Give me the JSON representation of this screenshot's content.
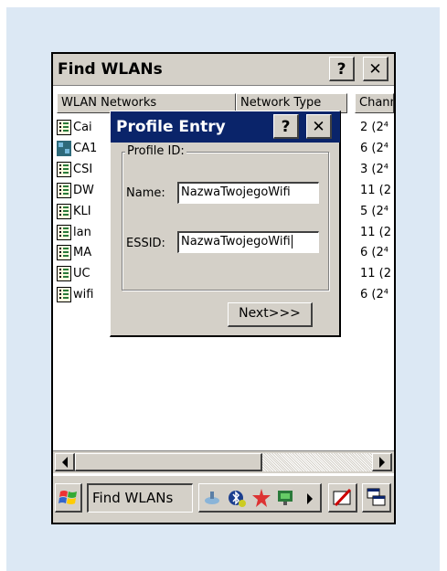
{
  "window": {
    "title": "Find WLANs",
    "help_label": "?",
    "close_label": "✕"
  },
  "columns": [
    "WLAN Networks",
    "Network Type",
    "Channel"
  ],
  "networks": [
    {
      "name": "Cai",
      "channel": "2 (2⁴",
      "icon": "network-icon"
    },
    {
      "name": "CA1",
      "channel": "6 (2⁴",
      "icon": "network-icon-adhoc"
    },
    {
      "name": "CSI",
      "channel": "3 (2⁴",
      "icon": "network-icon"
    },
    {
      "name": "DW",
      "channel": "11 (2",
      "icon": "network-icon"
    },
    {
      "name": "KLI",
      "channel": "5 (2⁴",
      "icon": "network-icon"
    },
    {
      "name": "lan",
      "channel": "11 (2",
      "icon": "network-icon"
    },
    {
      "name": "MA",
      "channel": "6 (2⁴",
      "icon": "network-icon"
    },
    {
      "name": "UC",
      "channel": "11 (2",
      "icon": "network-icon"
    },
    {
      "name": "wifi",
      "channel": "6 (2⁴",
      "icon": "network-icon"
    }
  ],
  "dialog": {
    "title": "Profile Entry",
    "help_label": "?",
    "close_label": "✕",
    "group_label": "Profile ID:",
    "name_label": "Name:",
    "name_value": "NazwaTwojegoWifi",
    "essid_label": "ESSID:",
    "essid_value": "NazwaTwojegoWifi",
    "next_label": "Next>>>"
  },
  "taskbar": {
    "task_label": "Find WLANs"
  }
}
